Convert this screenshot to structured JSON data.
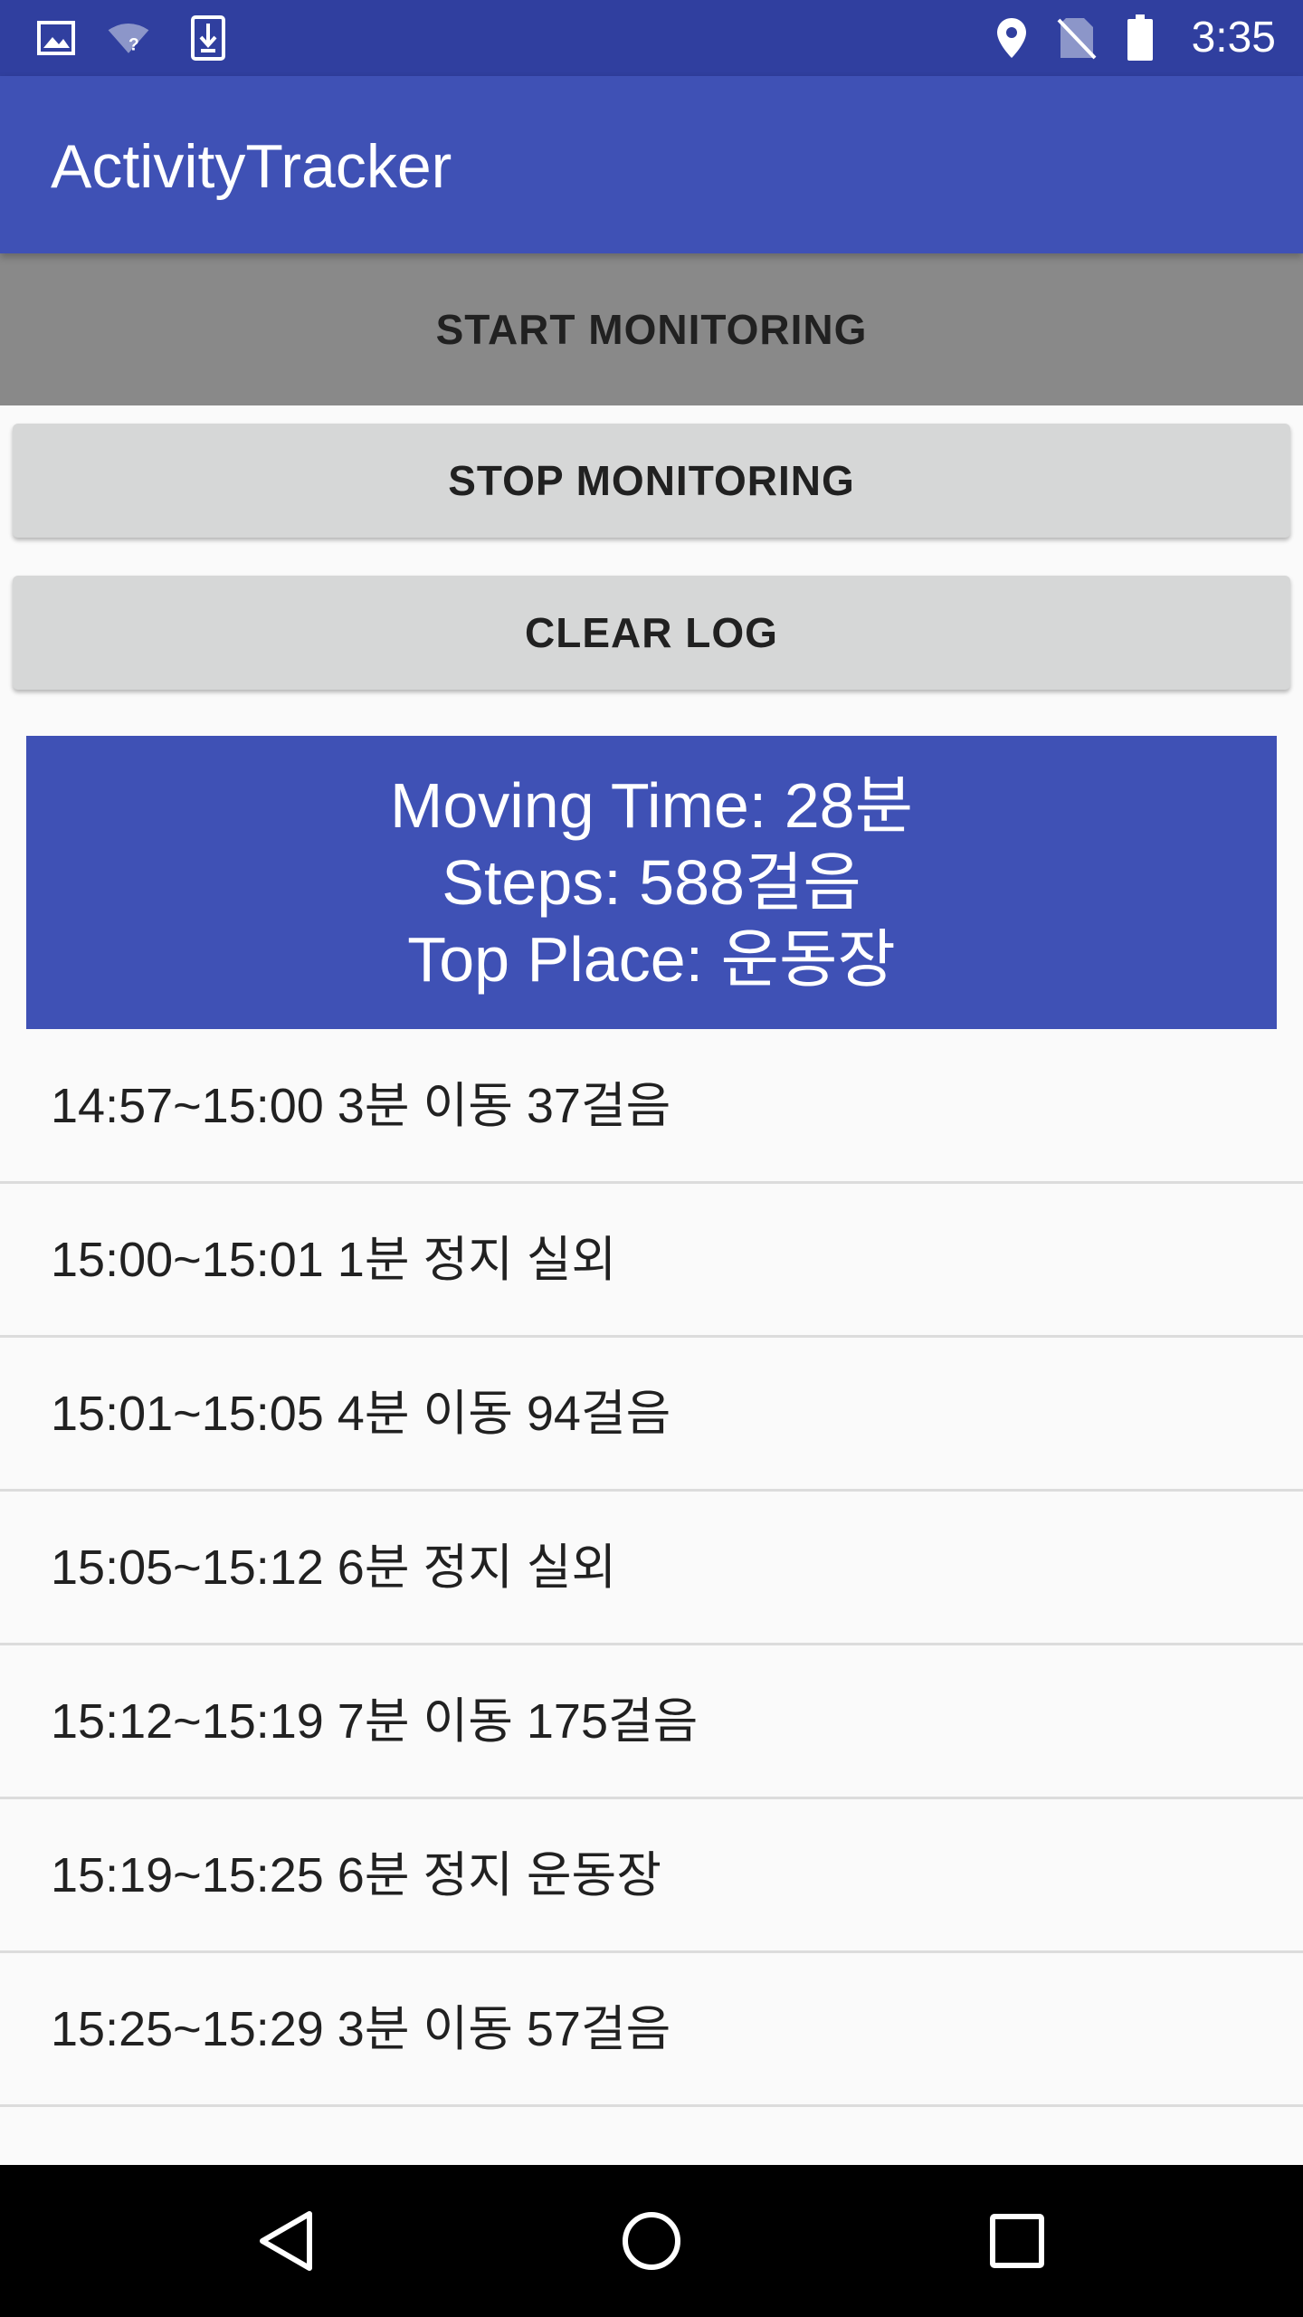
{
  "status_bar": {
    "time": "3:35",
    "left_icons": [
      "image-icon",
      "wifi-unknown-icon",
      "download-icon"
    ],
    "right_icons": [
      "location-icon",
      "no-sim-icon",
      "battery-icon"
    ],
    "color": "#303f9f"
  },
  "app_bar": {
    "title": "ActivityTracker",
    "color": "#3f51b5"
  },
  "buttons": {
    "start_label": "START MONITORING",
    "stop_label": "STOP MONITORING",
    "clear_label": "CLEAR LOG"
  },
  "summary": {
    "moving_time": "Moving Time: 28분",
    "steps": "Steps: 588걸음",
    "top_place": "Top Place: 운동장",
    "color": "#3f51b5"
  },
  "log": [
    "14:57~15:00 3분 이동 37걸음",
    "15:00~15:01 1분 정지 실외",
    "15:01~15:05 4분 이동 94걸음",
    "15:05~15:12 6분 정지 실외",
    "15:12~15:19 7분 이동 175걸음",
    "15:19~15:25 6분 정지 운동장",
    "15:25~15:29 3분 이동 57걸음"
  ],
  "nav_bar": {
    "icons": [
      "back-icon",
      "home-icon",
      "recents-icon"
    ]
  }
}
